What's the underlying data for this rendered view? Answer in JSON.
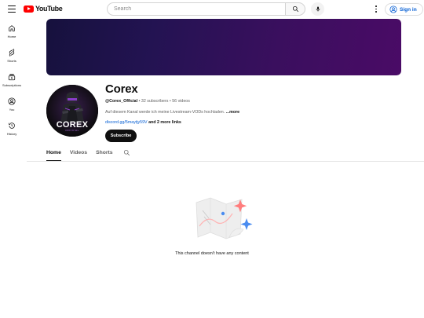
{
  "header": {
    "logo_text": "YouTube",
    "search_placeholder": "Search",
    "signin_label": "Sign in"
  },
  "sidebar": {
    "items": [
      {
        "label": "Home",
        "icon": "home-icon"
      },
      {
        "label": "Shorts",
        "icon": "shorts-icon"
      },
      {
        "label": "Subscriptions",
        "icon": "subscriptions-icon"
      },
      {
        "label": "You",
        "icon": "you-icon"
      },
      {
        "label": "History",
        "icon": "history-icon"
      }
    ]
  },
  "channel": {
    "name": "Corex",
    "handle": "@Corex_Official",
    "separator": "•",
    "subscribers": "32 subscribers",
    "videos": "56 videos",
    "description": "Auf diesem Kanal werde ich meine Livestream-VODs hochladen.",
    "more_label": "...more",
    "link": "discord.gg/5maytjy59V",
    "more_links": "and 2 more links",
    "subscribe_label": "Subscribe",
    "avatar_text": "COREX",
    "avatar_subtext": "OFFICIAL"
  },
  "tabs": [
    {
      "label": "Home",
      "active": true
    },
    {
      "label": "Videos",
      "active": false
    },
    {
      "label": "Shorts",
      "active": false
    }
  ],
  "empty_state": {
    "message": "This channel doesn't have any content"
  },
  "colors": {
    "brand_red": "#ff0000",
    "link_blue": "#065fd4",
    "banner_start": "#16113d",
    "banner_end": "#4a0b66"
  }
}
